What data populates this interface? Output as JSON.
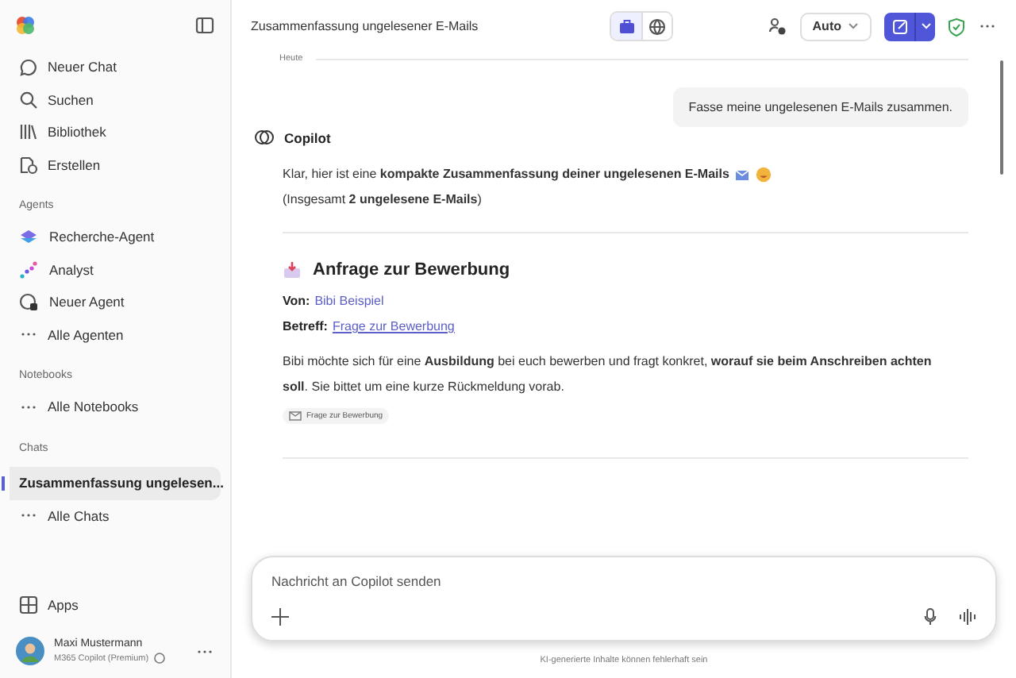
{
  "sidebar": {
    "nav": [
      {
        "label": "Neuer Chat"
      },
      {
        "label": "Suchen"
      },
      {
        "label": "Bibliothek"
      },
      {
        "label": "Erstellen"
      }
    ],
    "sections": [
      {
        "title": "Agents",
        "items": [
          {
            "label": "Recherche-Agent",
            "kind": "agent"
          },
          {
            "label": "Analyst",
            "kind": "agent"
          },
          {
            "label": "Neuer Agent",
            "kind": "agent"
          },
          {
            "label": "Alle Agenten",
            "kind": "more"
          }
        ]
      },
      {
        "title": "Notebooks",
        "items": [
          {
            "label": "Alle Notebooks",
            "kind": "more"
          }
        ]
      },
      {
        "title": "Chats",
        "items": [
          {
            "label": "Zusammenfassung ungelesen...",
            "kind": "chat",
            "selected": true
          },
          {
            "label": "Alle Chats",
            "kind": "more",
            "selected": false
          }
        ]
      }
    ],
    "apps": "Apps",
    "user": {
      "name": "Maxi Mustermann",
      "plan": "M365 Copilot (Premium)"
    }
  },
  "header": {
    "title": "Zusammenfassung ungelesener E-Mails",
    "modes": [
      {
        "selected": true
      },
      {
        "selected": false
      }
    ],
    "model": "Auto"
  },
  "chat": {
    "date": "Heute",
    "user_message": "Fasse meine ungelesenen E-Mails zusammen.",
    "assistant": "Copilot",
    "intro": "Klar, hier ist eine **kompakte Zusammenfassung deiner ungelesenen E-Mails**",
    "count": "(Insgesamt **2 ungelesene E-Mails**)",
    "email": {
      "title": "Anfrage zur Bewerbung",
      "from_label": "Von:",
      "from": "Bibi Beispiel",
      "subject_label": "Betreff:",
      "subject": "Frage zur Bewerbung",
      "body": "Bibi möchte sich für eine **Ausbildung** bei euch bewerben und fragt konkret, **worauf sie beim Anschreiben achten soll**. Sie bittet um eine kurze Rückmeldung vorab.",
      "chip": "Frage zur Bewerbung"
    }
  },
  "composer": {
    "placeholder": "Nachricht an Copilot senden"
  },
  "footer": "KI-generierte Inhalte können fehlerhaft sein"
}
